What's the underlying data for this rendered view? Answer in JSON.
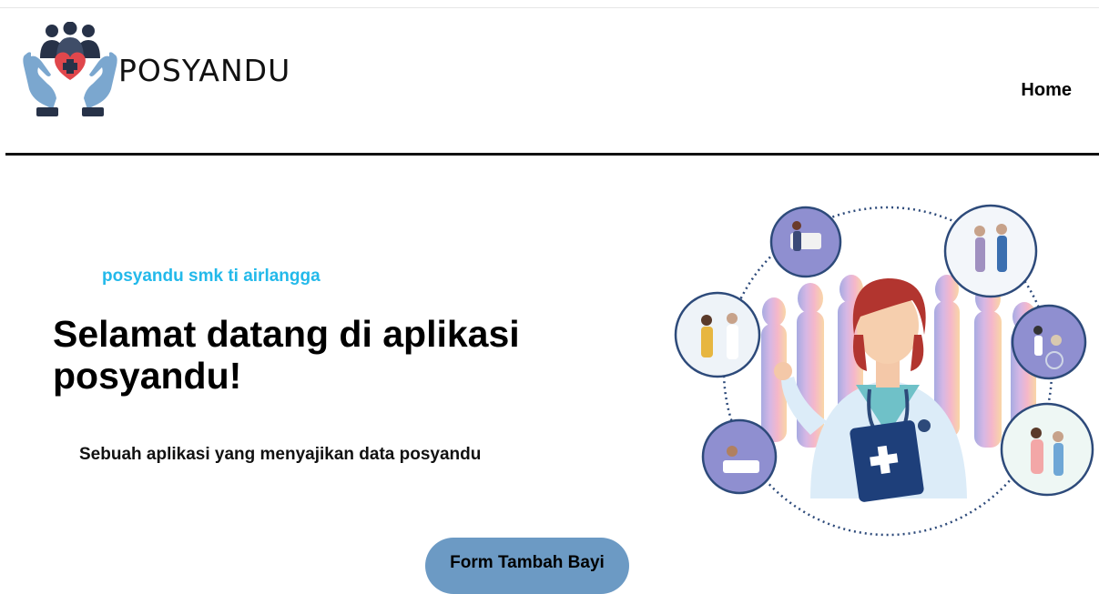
{
  "header": {
    "brand": "POSYANDU",
    "nav": {
      "home_label": "Home"
    }
  },
  "hero": {
    "tagline": "posyandu smk ti airlangga",
    "headline": "Selamat datang di aplikasi posyandu!",
    "description": "Sebuah aplikasi yang menyajikan data posyandu",
    "cta_label": "Form Tambah Bayi",
    "illustration": "doctor-with-community-health-illustration"
  },
  "colors": {
    "tagline": "#23b9ea",
    "cta_background": "#6c9ac4",
    "logo_hands": "#7ba7cf",
    "logo_heart": "#e0474c",
    "logo_people": "#273248"
  },
  "icons": {
    "logo": "hands-holding-heart-and-people-icon"
  }
}
